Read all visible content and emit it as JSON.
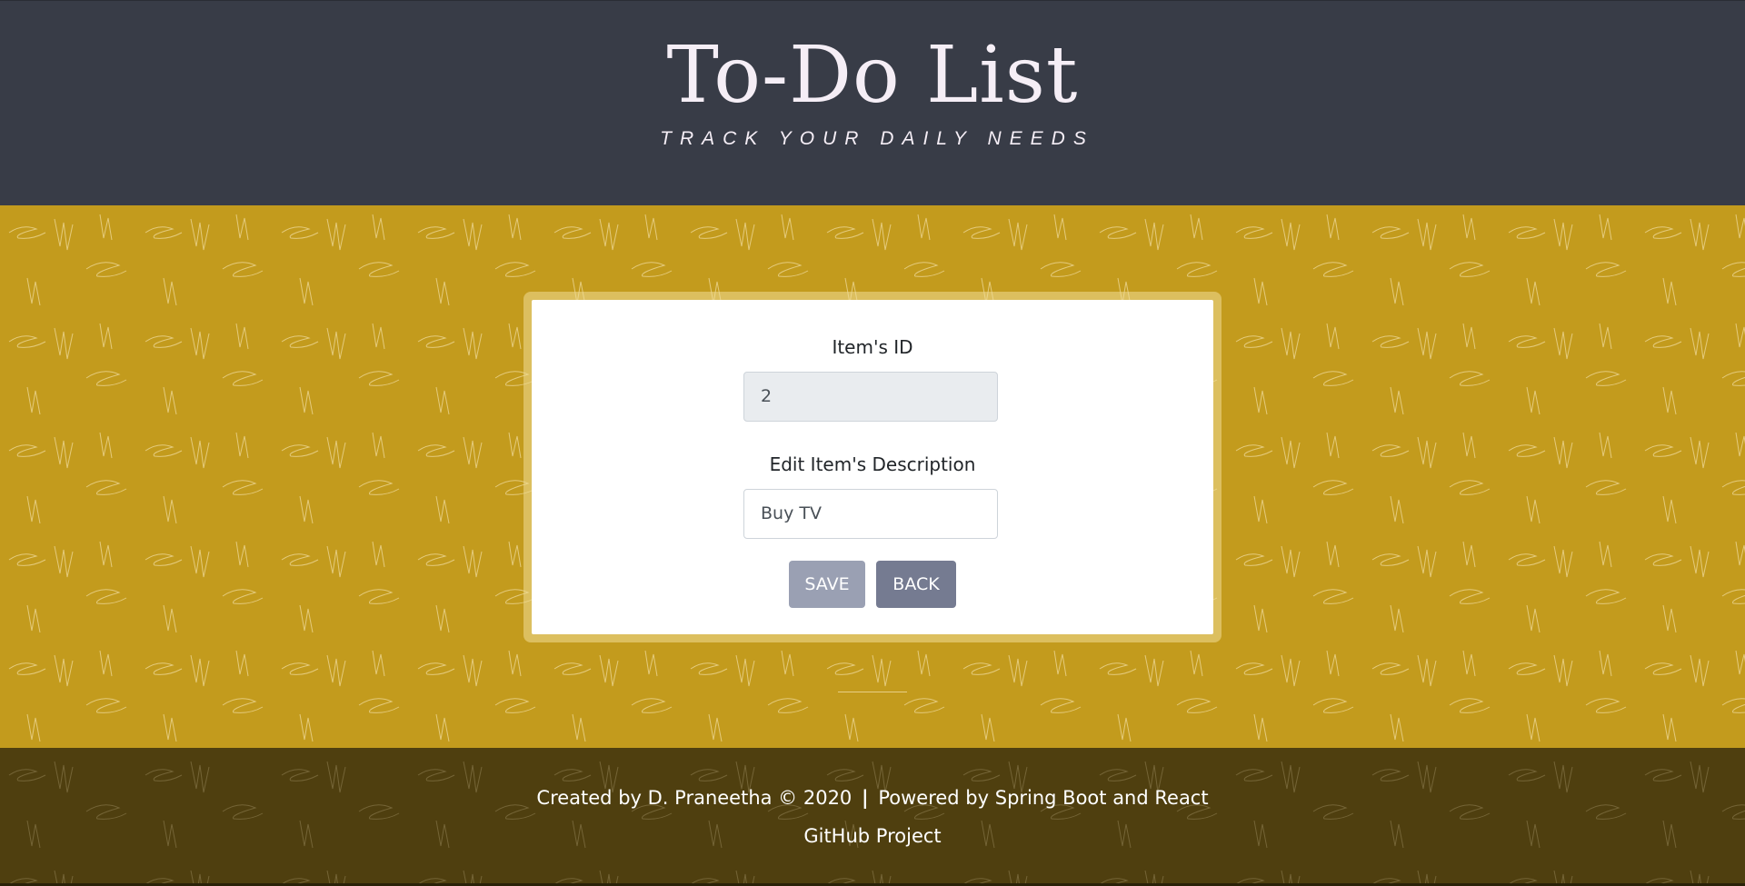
{
  "header": {
    "title": "To-Do List",
    "subtitle": "TRACK YOUR DAILY NEEDS"
  },
  "form": {
    "id_label": "Item's ID",
    "id_value": "2",
    "description_label": "Edit Item's Description",
    "description_value": "Buy TV",
    "save_label": "SAVE",
    "back_label": "BACK"
  },
  "footer": {
    "credit": "Created by D. Praneetha © 2020",
    "separator": "|",
    "powered": "Powered by Spring Boot and React",
    "link_label": "GitHub Project"
  },
  "colors": {
    "header_bg": "#383c47",
    "main_bg": "#c39b1d",
    "footer_bg": "#4f3f0f",
    "save_button": "#9aa0b3",
    "back_button": "#757b91"
  }
}
